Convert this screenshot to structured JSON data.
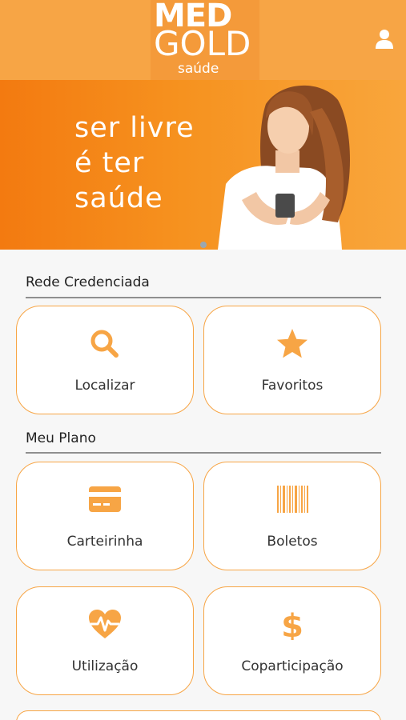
{
  "header": {
    "logo": {
      "line1": "MED",
      "line2": "GOLD",
      "line3": "saúde"
    },
    "user_icon": "user-icon"
  },
  "banner": {
    "lines": [
      "ser livre",
      "é ter",
      "saúde"
    ],
    "image": "woman-holding-phone"
  },
  "sections": {
    "rede": {
      "title": "Rede Credenciada",
      "cards": [
        {
          "label": "Localizar",
          "icon": "search-icon"
        },
        {
          "label": "Favoritos",
          "icon": "star-icon"
        }
      ]
    },
    "plano": {
      "title": "Meu Plano",
      "cards": [
        {
          "label": "Carteirinha",
          "icon": "credit-card-icon"
        },
        {
          "label": "Boletos",
          "icon": "barcode-icon"
        },
        {
          "label": "Utilização",
          "icon": "heartbeat-icon"
        },
        {
          "label": "Coparticipação",
          "icon": "dollar-icon"
        }
      ]
    }
  },
  "colors": {
    "accent": "#f7a545",
    "banner": "#f6921f",
    "background": "#f7f7f7"
  }
}
